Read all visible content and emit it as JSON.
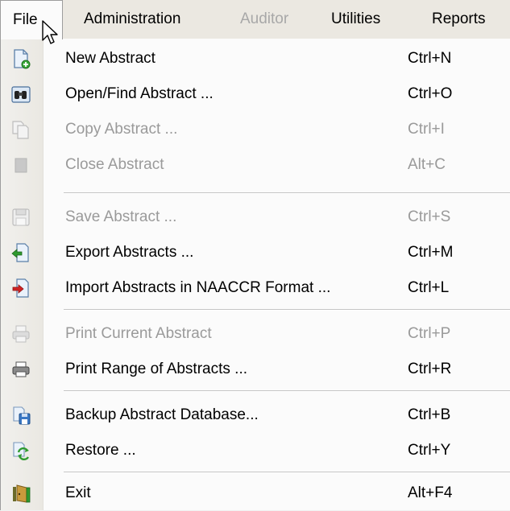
{
  "menubar": {
    "items": [
      {
        "label": "File",
        "enabled": true
      },
      {
        "label": "Administration",
        "enabled": true
      },
      {
        "label": "Auditor",
        "enabled": false
      },
      {
        "label": "Utilities",
        "enabled": true
      },
      {
        "label": "Reports",
        "enabled": true
      }
    ]
  },
  "file_menu": {
    "groups": [
      [
        {
          "label": "New Abstract",
          "shortcut": "Ctrl+N",
          "enabled": true,
          "icon": "new-document-icon"
        },
        {
          "label": "Open/Find Abstract ...",
          "shortcut": "Ctrl+O",
          "enabled": true,
          "icon": "binoculars-icon"
        },
        {
          "label": "Copy Abstract ...",
          "shortcut": "Ctrl+I",
          "enabled": false,
          "icon": "copy-icon"
        },
        {
          "label": "Close Abstract",
          "shortcut": "Alt+C",
          "enabled": false,
          "icon": "close-document-icon"
        }
      ],
      [
        {
          "label": "Save Abstract ...",
          "shortcut": "Ctrl+S",
          "enabled": false,
          "icon": "save-icon"
        },
        {
          "label": "Export Abstracts ...",
          "shortcut": "Ctrl+M",
          "enabled": true,
          "icon": "export-icon"
        },
        {
          "label": "Import Abstracts in NAACCR Format ...",
          "shortcut": "Ctrl+L",
          "enabled": true,
          "icon": "import-icon"
        }
      ],
      [
        {
          "label": "Print Current Abstract",
          "shortcut": "Ctrl+P",
          "enabled": false,
          "icon": "print-icon"
        },
        {
          "label": "Print Range of Abstracts ...",
          "shortcut": "Ctrl+R",
          "enabled": true,
          "icon": "print-range-icon"
        }
      ],
      [
        {
          "label": "Backup Abstract Database...",
          "shortcut": "Ctrl+B",
          "enabled": true,
          "icon": "backup-icon"
        },
        {
          "label": "Restore ...",
          "shortcut": "Ctrl+Y",
          "enabled": true,
          "icon": "restore-icon"
        }
      ],
      [
        {
          "label": "Exit",
          "shortcut": "Alt+F4",
          "enabled": true,
          "icon": "exit-icon"
        }
      ]
    ]
  }
}
